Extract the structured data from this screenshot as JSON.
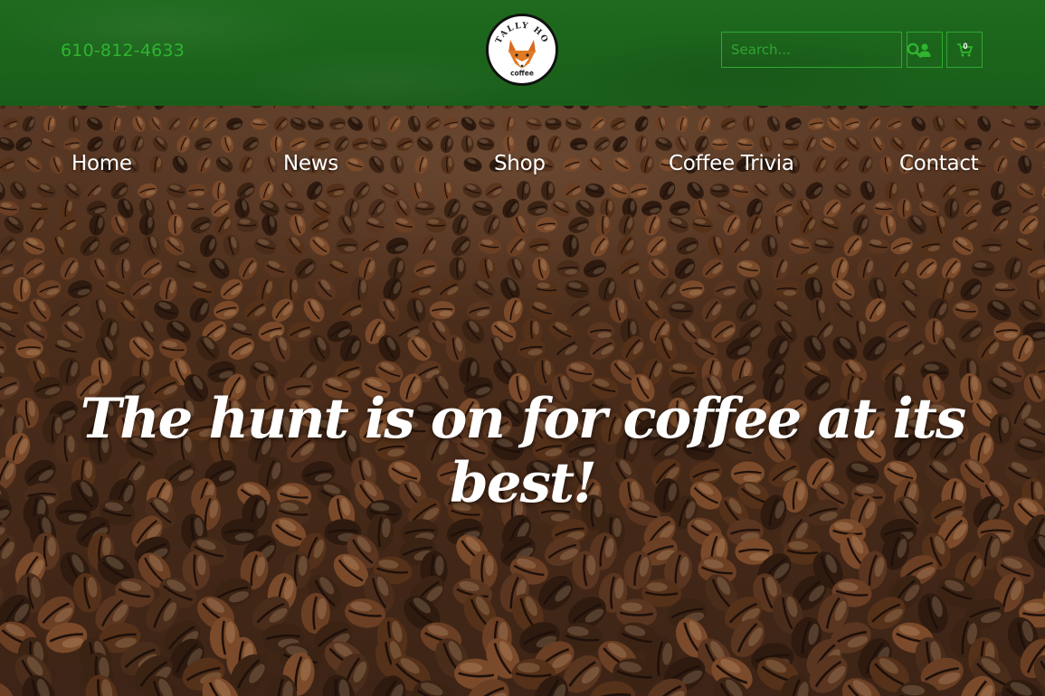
{
  "header": {
    "phone": "610-812-4633",
    "logo": {
      "top_text": "TALLY HO",
      "bottom_text": "coffee"
    },
    "search": {
      "placeholder": "Search..."
    },
    "cart_count": "0"
  },
  "icons": {
    "search": "search-icon",
    "account": "user-icon",
    "cart": "cart-icon",
    "logo_mascot": "fox-icon"
  },
  "nav": {
    "items": [
      {
        "label": "Home"
      },
      {
        "label": "News"
      },
      {
        "label": "Shop"
      },
      {
        "label": "Coffee Trivia"
      },
      {
        "label": "Contact"
      }
    ]
  },
  "hero": {
    "tagline": "The hunt is on for coffee at its best!"
  },
  "colors": {
    "header_green": "#1b601b",
    "accent_green": "#2fb52f",
    "bean_brown": "#4a2c1a",
    "text_white": "#ffffff"
  }
}
